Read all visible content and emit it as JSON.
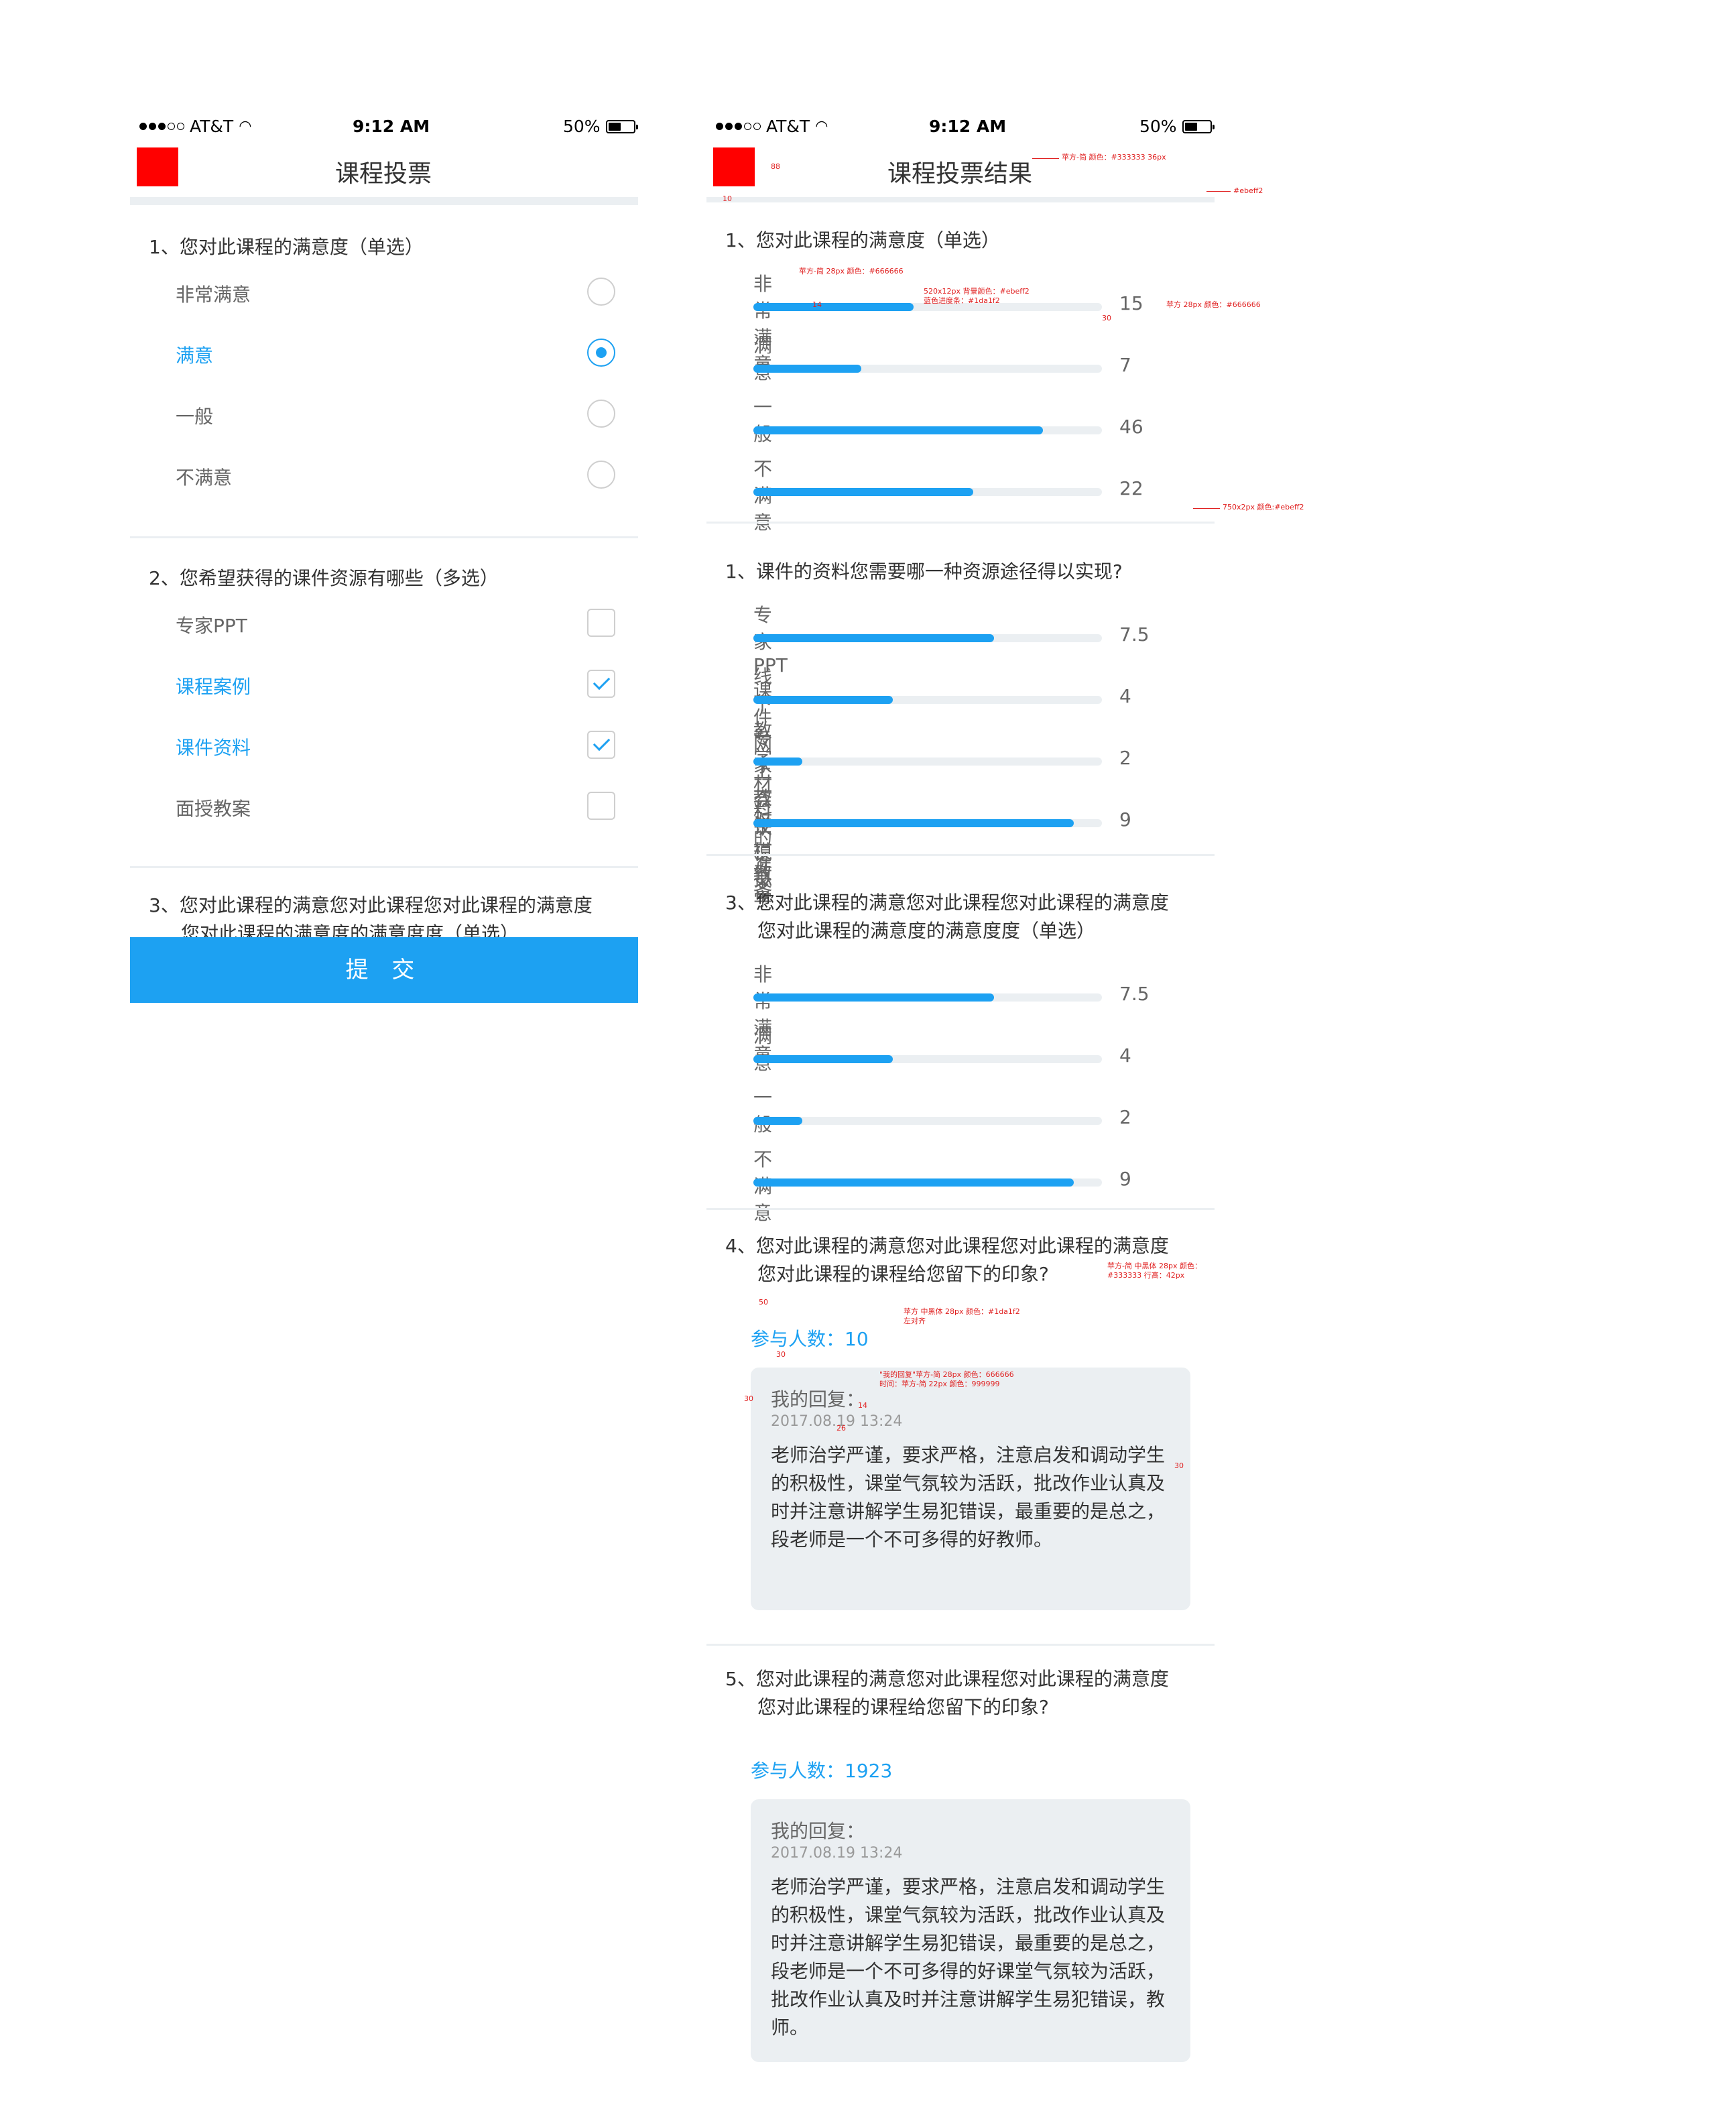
{
  "status": {
    "carrier": "AT&T",
    "time": "9:12 AM",
    "battery": "50%"
  },
  "left": {
    "title": "课程投票",
    "q1": {
      "title": "1、您对此课程的满意度（单选）",
      "options": [
        {
          "label": "非常满意",
          "selected": false
        },
        {
          "label": "满意",
          "selected": true
        },
        {
          "label": "一般",
          "selected": false
        },
        {
          "label": "不满意",
          "selected": false
        }
      ]
    },
    "q2": {
      "title": "2、您希望获得的课件资源有哪些（多选）",
      "options": [
        {
          "label": "专家PPT",
          "checked": false
        },
        {
          "label": "课程案例",
          "checked": true
        },
        {
          "label": "课件资料",
          "checked": true
        },
        {
          "label": "面授教案",
          "checked": false
        }
      ]
    },
    "q3": {
      "line1": "3、您对此课程的满意您对此课程您对此课程的满意度",
      "line2": "您对此课程的满意度的满意度度（单选）"
    },
    "submit": "提 交"
  },
  "right": {
    "title": "课程投票结果",
    "q1": {
      "title": "1、您对此课程的满意度（单选）",
      "items": [
        {
          "label": "非常满意",
          "value": "15",
          "fill": 0.46
        },
        {
          "label": "满意",
          "value": "7",
          "fill": 0.31
        },
        {
          "label": "一般",
          "value": "46",
          "fill": 0.83
        },
        {
          "label": "不满意",
          "value": "22",
          "fill": 0.63
        }
      ]
    },
    "q2": {
      "title": "1、课件的资料您需要哪一种资源途径得以实现?",
      "items": [
        {
          "label": "专家PPT课件网上教学模拟",
          "value": "7.5",
          "fill": 0.69
        },
        {
          "label": "线下教学材料的准备",
          "value": "4",
          "fill": 0.4
        },
        {
          "label": "专家一对一教学",
          "value": "2",
          "fill": 0.14
        },
        {
          "label": "会议记录",
          "value": "9",
          "fill": 0.92
        }
      ]
    },
    "q3": {
      "line1": "3、您对此课程的满意您对此课程您对此课程的满意度",
      "line2": "您对此课程的满意度的满意度度（单选）",
      "items": [
        {
          "label": "非常满意",
          "value": "7.5",
          "fill": 0.69
        },
        {
          "label": "满意",
          "value": "4",
          "fill": 0.4
        },
        {
          "label": "一般",
          "value": "2",
          "fill": 0.14
        },
        {
          "label": "不满意",
          "value": "9",
          "fill": 0.92
        }
      ]
    },
    "q4": {
      "line1": "4、您对此课程的满意您对此课程您对此课程的满意度",
      "line2": "您对此课程的课程给您留下的印象?",
      "participants": "参与人数：10",
      "reply_label": "我的回复：",
      "reply_time": "2017.08.19 13:24",
      "reply_text": "老师治学严谨，要求严格，注意启发和调动学生的积极性，课堂气氛较为活跃，批改作业认真及时并注意讲解学生易犯错误，最重要的是总之，段老师是一个不可多得的好教师。"
    },
    "q5": {
      "line1": "5、您对此课程的满意您对此课程您对此课程的满意度",
      "line2": "您对此课程的课程给您留下的印象?",
      "participants": "参与人数：1923",
      "reply_label": "我的回复：",
      "reply_time": "2017.08.19 13:24",
      "reply_text": "老师治学严谨，要求严格，注意启发和调动学生的积极性，课堂气氛较为活跃，批改作业认真及时并注意讲解学生易犯错误，最重要的是总之，段老师是一个不可多得的好课堂气氛较为活跃，批改作业认真及时并注意讲解学生易犯错误，教师。"
    }
  },
  "annotations": {
    "a1": "苹方-简  颜色：#333333  36px",
    "a2": "#ebeff2",
    "a3": "苹方-简 28px 颜色：#666666",
    "a4": "520x12px 背景颜色：#ebeff2",
    "a4b": "蓝色进度条：#1da1f2",
    "a5": "苹方 28px 颜色：#666666",
    "a6": "750x2px 颜色:#ebeff2",
    "a7": "苹方-简 中黑体 28px 颜色：",
    "a7b": "#333333 行高：42px",
    "a8": "苹方 中黑体  28px 颜色：#1da1f2",
    "a8b": "左对齐",
    "a9": "\"我的回复\"苹方-简 28px 颜色：666666",
    "a9b": "时间：苹方-简 22px  颜色：999999",
    "n30": "30",
    "n88": "88",
    "n10": "10",
    "n14": "14",
    "n26": "26",
    "n50": "50"
  },
  "colors": {
    "accent": "#1da1f2",
    "divider": "#ebeff2",
    "title": "#333333",
    "option": "#666666",
    "time": "#999999",
    "marker": "#ff0000"
  }
}
